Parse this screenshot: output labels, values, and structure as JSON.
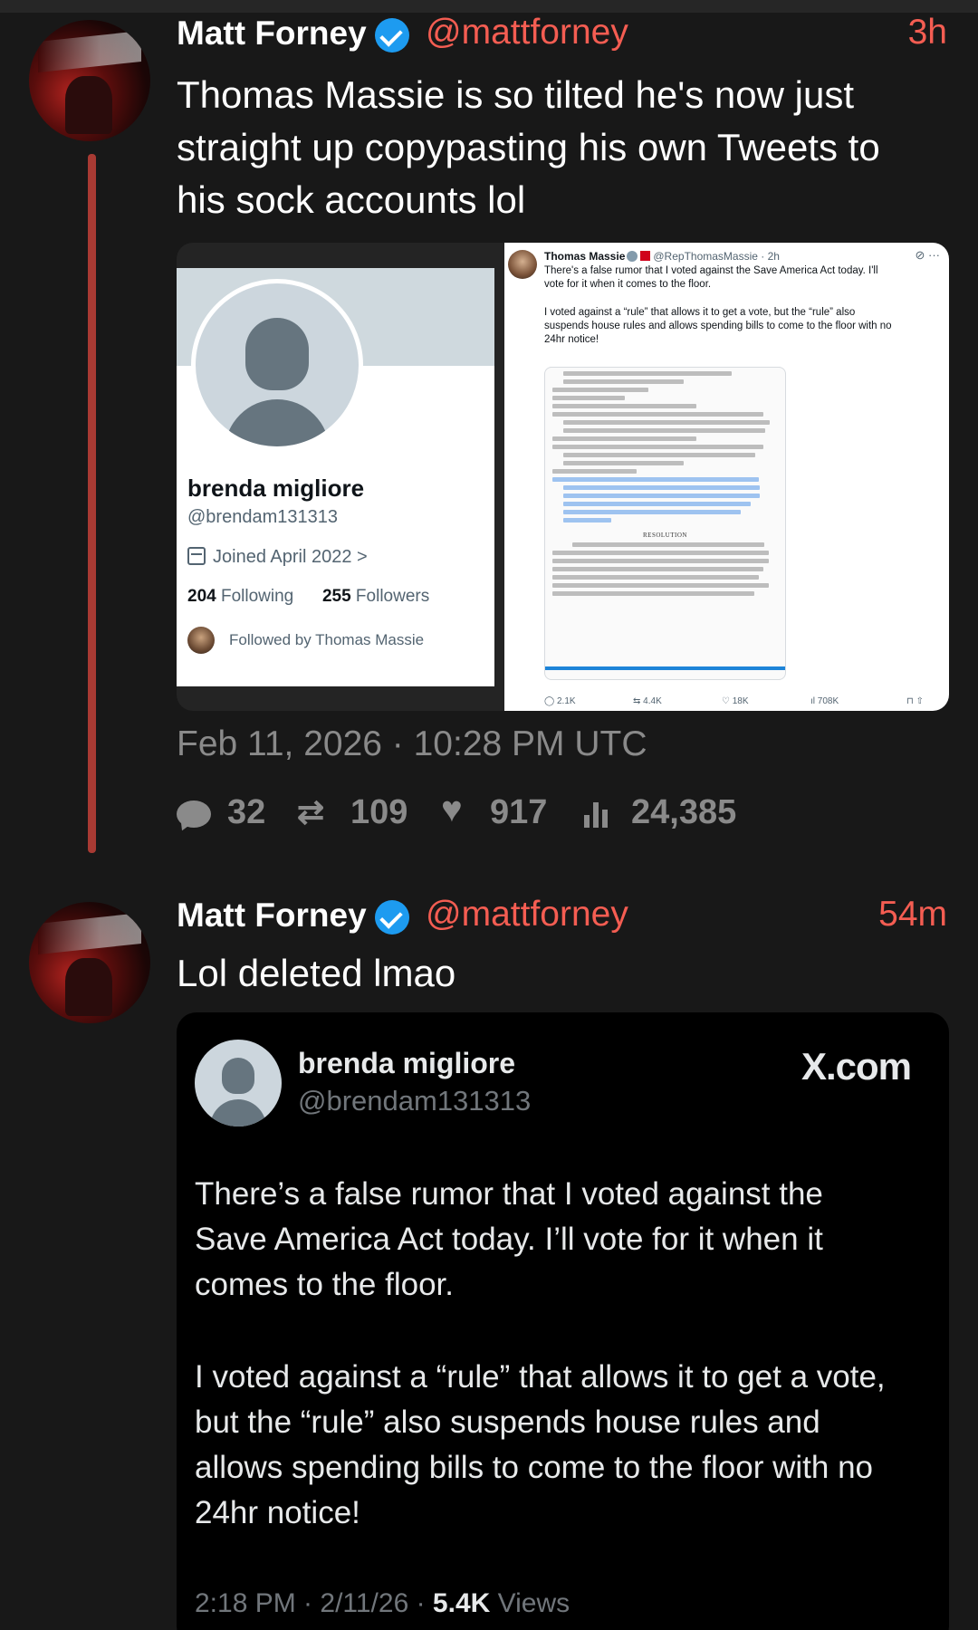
{
  "post1": {
    "author_name": "Matt Forney",
    "handle": "@mattforney",
    "time": "3h",
    "text_lines": [
      "Thomas Massie is so tilted he's now just",
      "straight up copypasting his own Tweets to",
      "his sock accounts lol"
    ],
    "profile_card": {
      "name": "brenda migliore",
      "handle": "@brendam131313",
      "joined": "Joined April 2022 >",
      "following_count": "204",
      "following_label": "Following",
      "followers_count": "255",
      "followers_label": "Followers",
      "followed_by": "Followed by Thomas Massie"
    },
    "embedded_tweet": {
      "name": "Thomas Massie",
      "handle_time": "@RepThomasMassie · 2h",
      "para1_lines": [
        "There's a false rumor that I voted against the Save America Act today. I'll",
        "vote for it when it comes to the floor."
      ],
      "para2_lines": [
        "I voted against a “rule” that allows it to get a vote, but the “rule” also",
        "suspends house rules and allows spending bills to come to the floor with no",
        "24hr notice!"
      ],
      "doc_heading": "RESOLUTION",
      "replies": "2.1K",
      "reposts": "4.4K",
      "likes": "18K",
      "views": "708K"
    },
    "datetime": "Feb 11, 2026 · 10:28 PM UTC",
    "replies": "32",
    "reposts": "109",
    "likes": "917",
    "views": "24,385"
  },
  "post2": {
    "author_name": "Matt Forney",
    "handle": "@mattforney",
    "time": "54m",
    "text": "Lol deleted lmao",
    "quote": {
      "name": "brenda migliore",
      "handle": "@brendam131313",
      "brand": "X.com",
      "para1_lines": [
        "There’s a false rumor that I voted against the",
        "Save America Act today. I’ll vote for it when it",
        "comes to the floor."
      ],
      "para2_lines": [
        "I voted against a “rule” that allows it to get a vote,",
        "but the “rule” also suspends house rules and",
        "allows spending bills to come to the floor with no",
        "24hr notice!"
      ],
      "footer_time": "2:18 PM · 2/11/26 · ",
      "footer_views_count": "5.4K",
      "footer_views_label": " Views"
    }
  },
  "colors": {
    "background": "#181818",
    "accent": "#f45d52",
    "thread_line": "#a83a33",
    "verified": "#1d9bf0",
    "muted": "#8a8a8a"
  },
  "icons": [
    "verified-badge-icon",
    "reply-bubble-icon",
    "repost-icon",
    "heart-icon",
    "views-bars-icon",
    "calendar-icon"
  ]
}
